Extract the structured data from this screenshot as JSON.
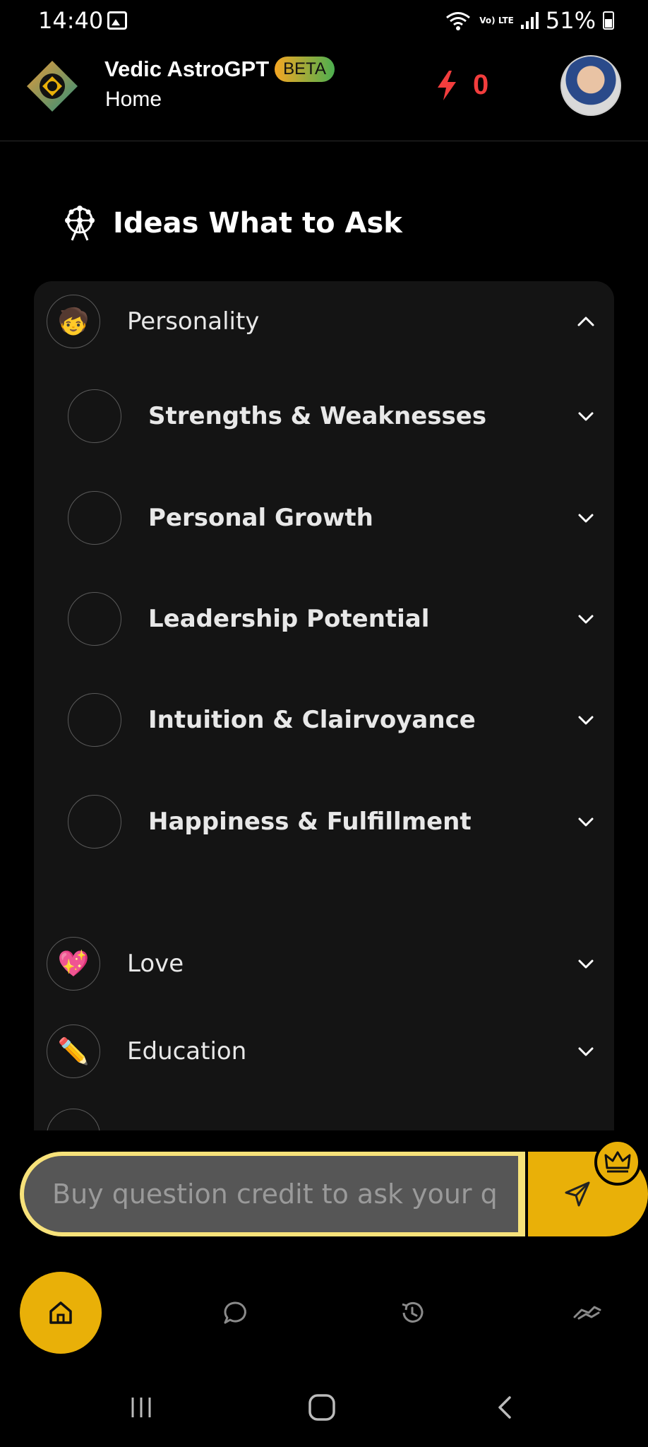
{
  "status_bar": {
    "time": "14:40",
    "network_label": "Vo) LTE",
    "battery": "51%"
  },
  "header": {
    "app_name": "Vedic AstroGPT",
    "badge": "BETA",
    "subtitle": "Home",
    "credits": "0",
    "accent_color": "#e9b008",
    "credits_color": "#f23d3d"
  },
  "section": {
    "title": "Ideas What to Ask"
  },
  "categories": [
    {
      "label": "Personality",
      "emoji": "🧒",
      "expanded": true
    },
    {
      "label": "Love",
      "emoji": "💖",
      "expanded": false
    },
    {
      "label": "Education",
      "emoji": "✏️",
      "expanded": false
    }
  ],
  "personality_topics": [
    "Strengths & Weaknesses",
    "Personal Growth",
    "Leadership Potential",
    "Intuition & Clairvoyance",
    "Happiness & Fulfillment"
  ],
  "composer": {
    "placeholder": "Buy question credit to ask your q"
  },
  "bottom_nav": {
    "items": [
      "home-icon",
      "chat-icon",
      "history-icon",
      "handshake-icon"
    ],
    "active": "home-icon"
  }
}
